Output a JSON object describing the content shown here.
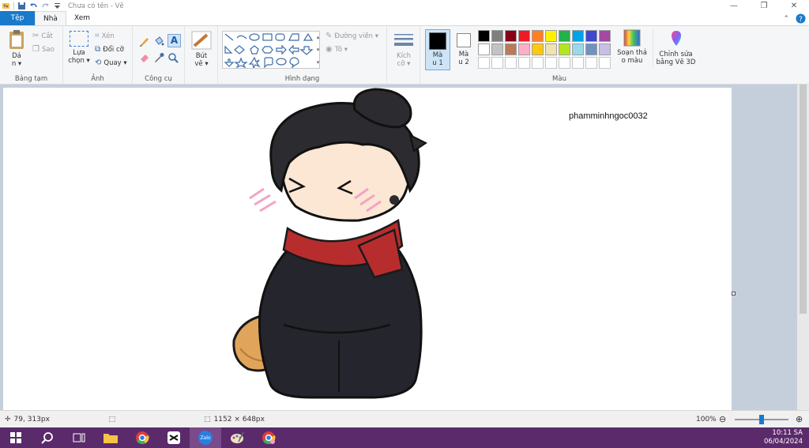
{
  "window": {
    "title": "Chưa có tên - Vẽ"
  },
  "tabs": {
    "file": "Tệp",
    "home": "Nhà",
    "view": "Xem"
  },
  "clipboard": {
    "paste": "Dá",
    "paste_sub": "n ▾",
    "cut": "Cắt",
    "copy": "Sao",
    "group": "Bảng tạm"
  },
  "image": {
    "select": "Lựa",
    "select_sub": "chọn ▾",
    "crop": "Xén",
    "resize": "Đổi cỡ",
    "rotate": "Quay ▾",
    "group": "Ảnh"
  },
  "tools": {
    "group": "Công cụ"
  },
  "brushes": {
    "label": "Bút",
    "label_sub": "vẽ ▾"
  },
  "shapes": {
    "outline": "Đường viền ▾",
    "fill": "Tô ▾",
    "group": "Hình dạng"
  },
  "size": {
    "label": "Kích",
    "label_sub": "cỡ ▾"
  },
  "colors": {
    "color1": "Mà",
    "color1_sub": "u 1",
    "color2": "Mà",
    "color2_sub": "u 2",
    "edit": "Soạn thả",
    "edit_sub": "o màu",
    "paint3d": "Chỉnh sửa",
    "paint3d_sub": "bằng Vẽ 3D",
    "group": "Màu",
    "swatches": [
      "#000000",
      "#7f7f7f",
      "#880015",
      "#ed1c24",
      "#ff7f27",
      "#fff200",
      "#22b14c",
      "#00a2e8",
      "#3f48cc",
      "#a349a4",
      "#ffffff",
      "#c3c3c3",
      "#b97a57",
      "#ffaec9",
      "#ffc90e",
      "#efe4b0",
      "#b5e61d",
      "#99d9ea",
      "#7092be",
      "#c8bfe7",
      "#ffffff",
      "#ffffff",
      "#ffffff",
      "#ffffff",
      "#ffffff",
      "#ffffff",
      "#ffffff",
      "#ffffff",
      "#ffffff",
      "#ffffff"
    ]
  },
  "canvas": {
    "watermark": "phamminhngoc0032"
  },
  "status": {
    "cursor": "79, 313px",
    "size": "1152 × 648px",
    "zoom": "100%"
  },
  "clock": {
    "time": "10:11 SA",
    "date": "06/04/2024"
  },
  "taskbar": {
    "zalo": "Zalo"
  }
}
